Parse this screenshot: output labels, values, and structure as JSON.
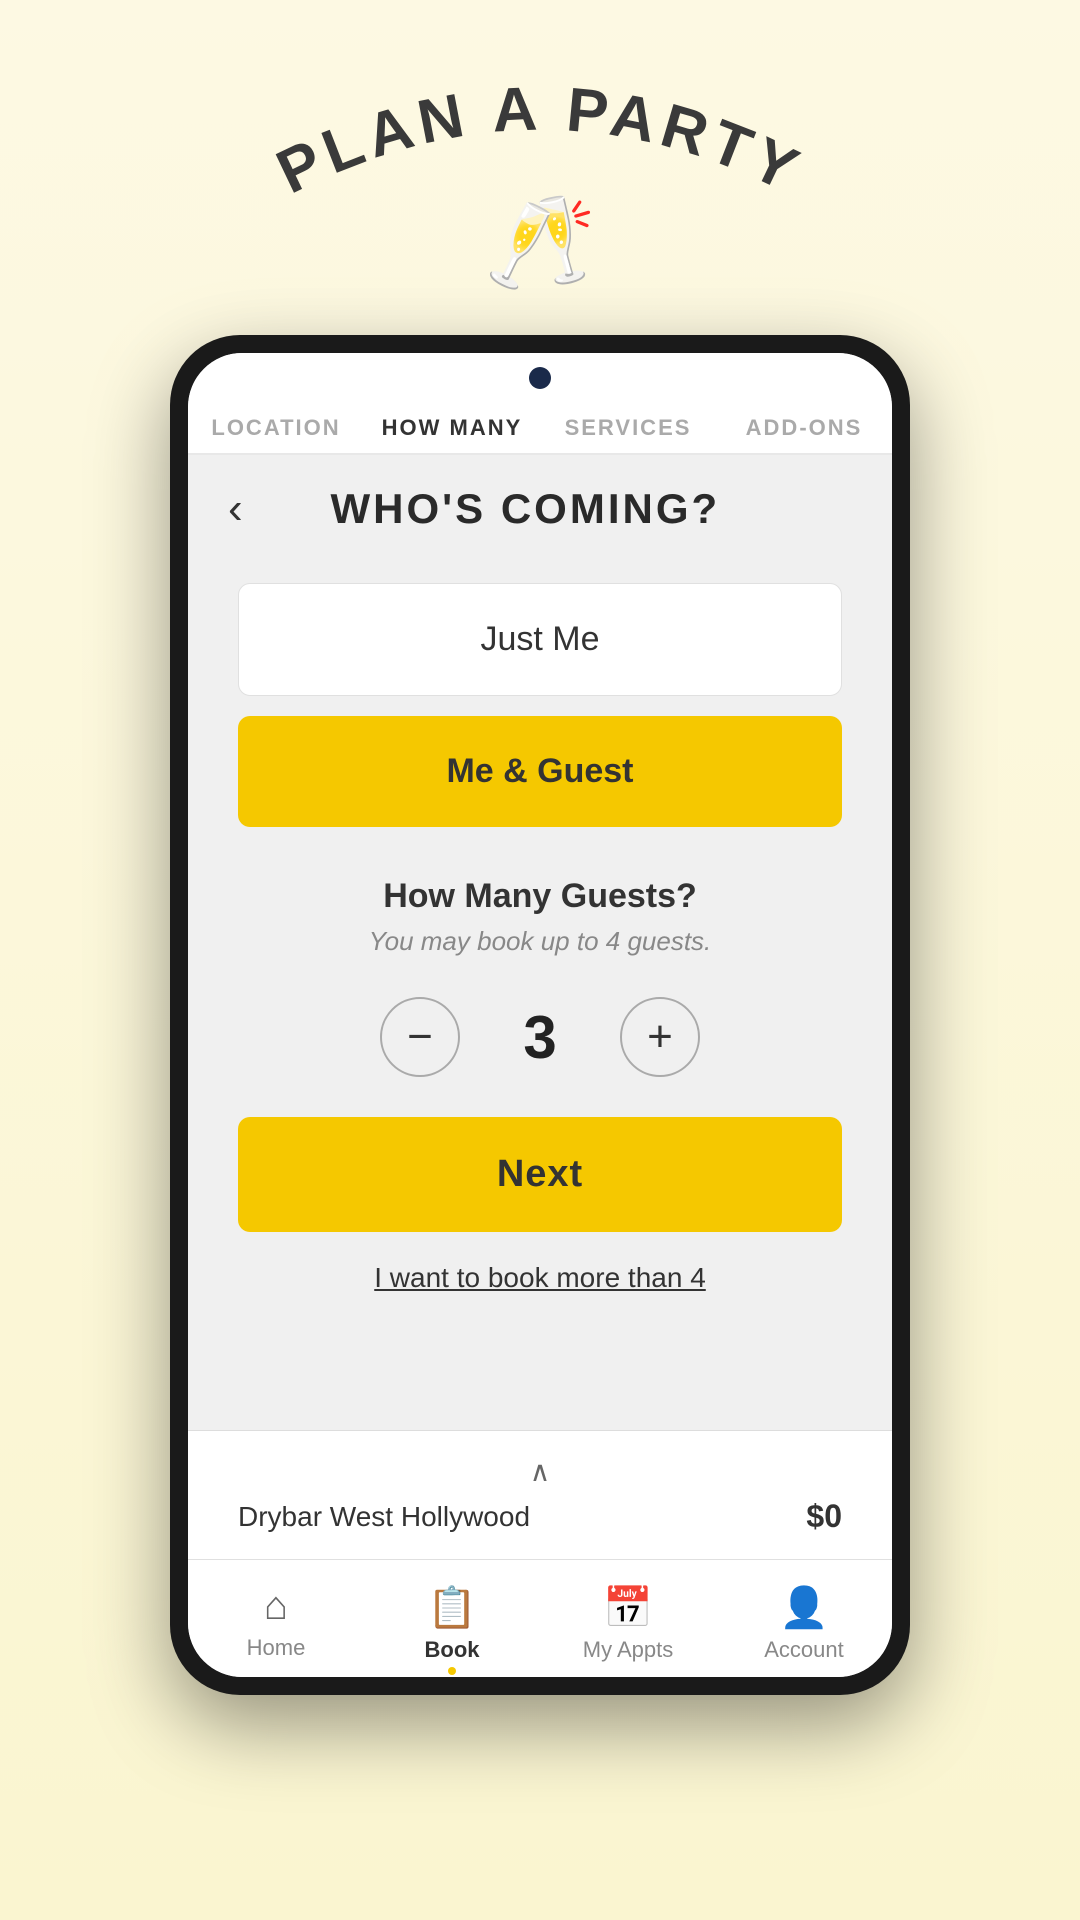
{
  "page": {
    "background_gradient_start": "#fdf9e3",
    "background_gradient_end": "#faf5d0"
  },
  "header": {
    "arch_title": "PLAN A PARTY",
    "champagne_emoji": "🥂"
  },
  "tabs": [
    {
      "id": "location",
      "label": "LOCATION",
      "active": false
    },
    {
      "id": "how_many",
      "label": "HOW MANY",
      "active": true
    },
    {
      "id": "services",
      "label": "SERVICES",
      "active": false
    },
    {
      "id": "add_ons",
      "label": "ADD-ONS",
      "active": false
    }
  ],
  "screen": {
    "back_label": "‹",
    "title": "WHO'S COMING?",
    "options": [
      {
        "id": "just_me",
        "label": "Just Me",
        "selected": false
      },
      {
        "id": "me_and_guest",
        "label": "Me & Guest",
        "selected": true
      }
    ],
    "guests": {
      "title": "How Many Guests?",
      "subtitle": "You may book up to 4 guests.",
      "count": "3",
      "decrement_label": "−",
      "increment_label": "+"
    },
    "next_button": "Next",
    "more_than_4_link": "I want to book more than 4"
  },
  "summary_bar": {
    "chevron": "∧",
    "location": "Drybar West Hollywood",
    "price": "$0"
  },
  "bottom_nav": [
    {
      "id": "home",
      "label": "Home",
      "icon": "⌂",
      "active": false
    },
    {
      "id": "book",
      "label": "Book",
      "icon": "📋",
      "active": true
    },
    {
      "id": "my_appts",
      "label": "My Appts",
      "icon": "📅",
      "active": false
    },
    {
      "id": "account",
      "label": "Account",
      "icon": "👤",
      "active": false
    }
  ]
}
